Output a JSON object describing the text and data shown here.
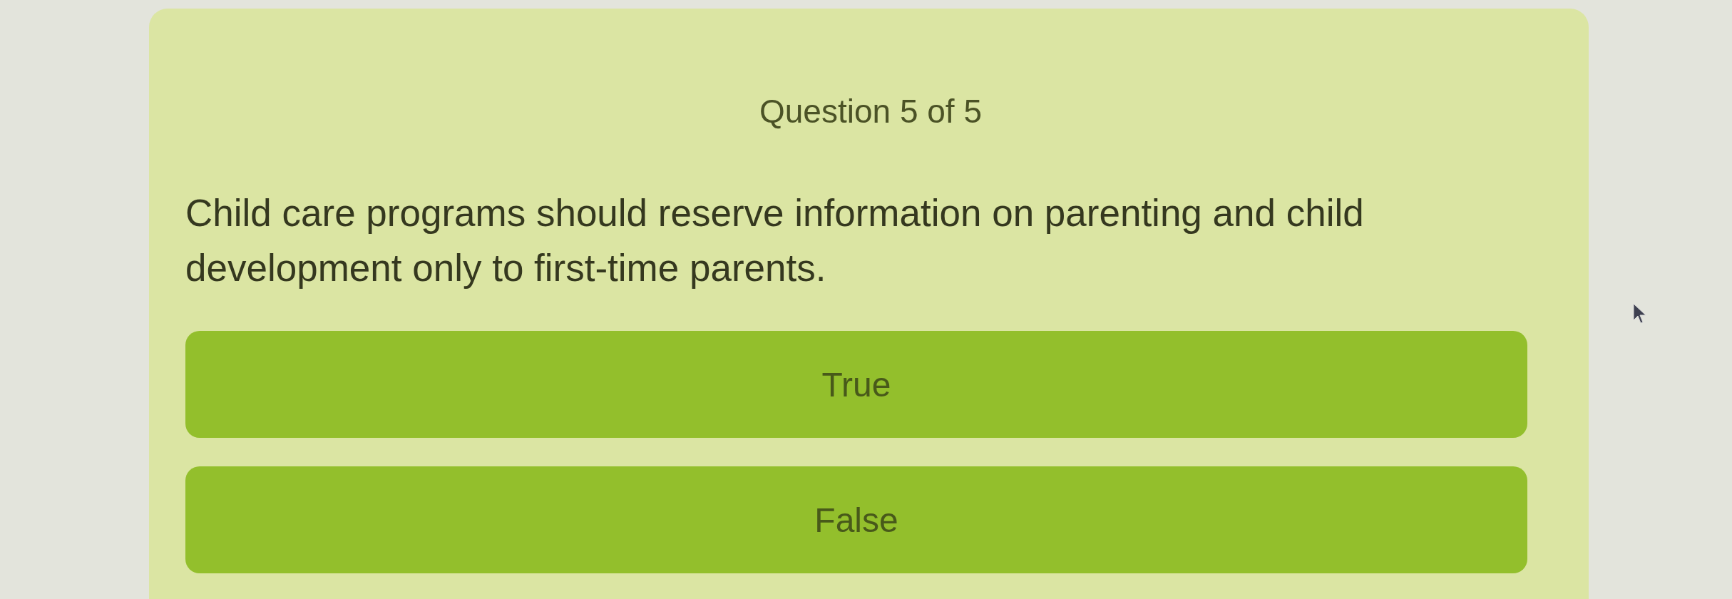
{
  "quiz": {
    "progress": "Question 5 of 5",
    "question": "Child care programs should reserve information on parenting and child development only to first-time parents.",
    "options": [
      {
        "label": "True",
        "selected": false
      },
      {
        "label": "False",
        "selected": false
      }
    ]
  }
}
